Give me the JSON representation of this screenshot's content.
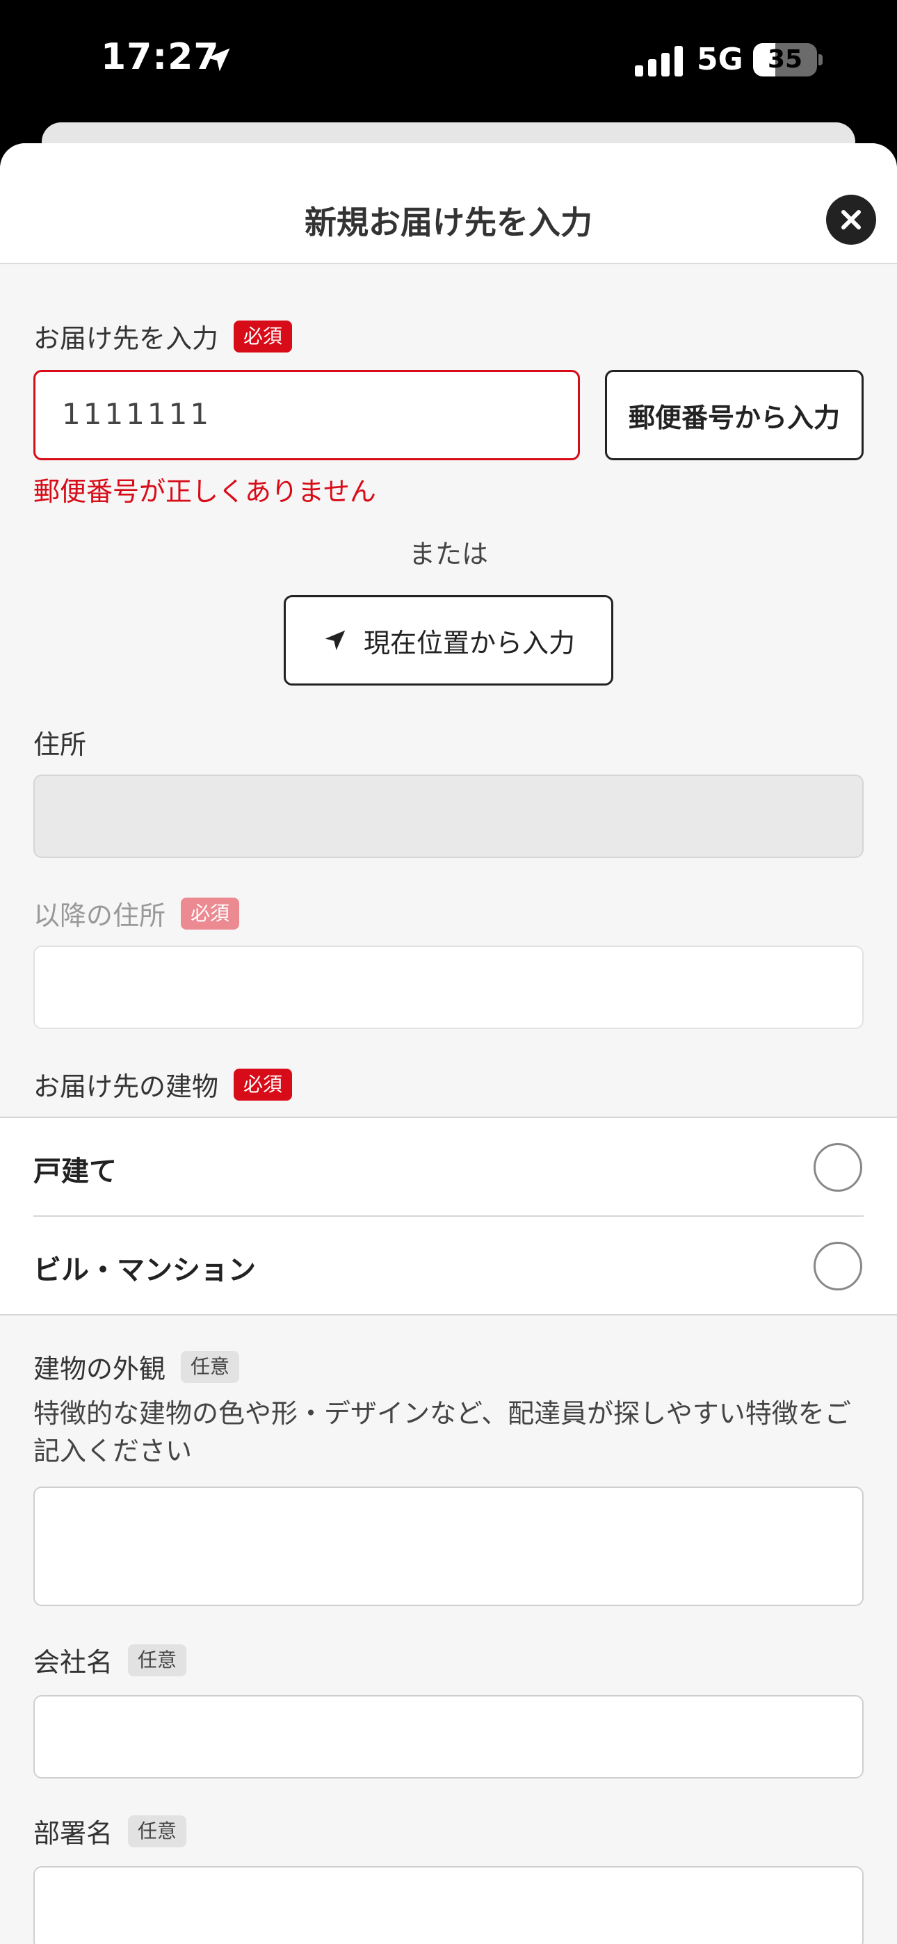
{
  "status_bar": {
    "time": "17:27",
    "network": "5G",
    "battery": "35"
  },
  "header": {
    "title": "新規お届け先を入力",
    "close_icon": "close-icon"
  },
  "postal": {
    "label": "お届け先を入力",
    "badge": "必須",
    "value": "1111111",
    "lookup_button": "郵便番号から入力",
    "error": "郵便番号が正しくありません",
    "or": "または",
    "location_button": "現在位置から入力"
  },
  "address": {
    "label": "住所"
  },
  "address_rest": {
    "label": "以降の住所",
    "badge": "必須"
  },
  "building": {
    "label": "お届け先の建物",
    "badge": "必須",
    "options": [
      {
        "label": "戸建て"
      },
      {
        "label": "ビル・マンション"
      }
    ]
  },
  "appearance": {
    "label": "建物の外観",
    "badge": "任意",
    "help": "特徴的な建物の色や形・デザインなど、配達員が探しやすい特徴をご記入ください"
  },
  "company": {
    "label": "会社名",
    "badge": "任意"
  },
  "department": {
    "label": "部署名",
    "badge": "任意"
  },
  "colors": {
    "accent_red": "#d80c18",
    "background": "#f6f6f6"
  }
}
